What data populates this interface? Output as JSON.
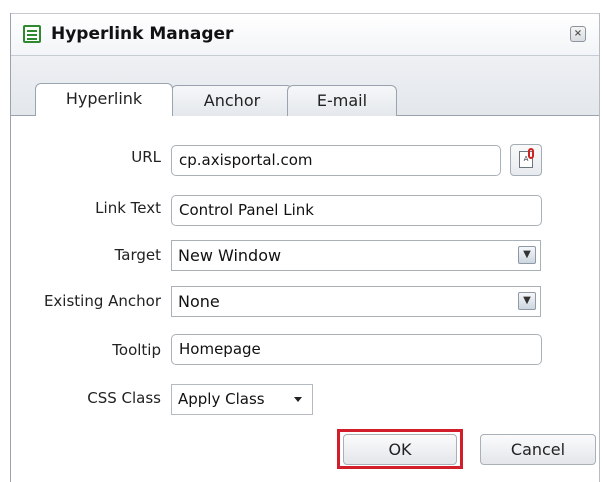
{
  "dialog": {
    "title": "Hyperlink Manager",
    "close_glyph": "×"
  },
  "tabs": [
    {
      "label": "Hyperlink",
      "active": true
    },
    {
      "label": "Anchor",
      "active": false
    },
    {
      "label": "E-mail",
      "active": false
    }
  ],
  "form": {
    "url": {
      "label": "URL",
      "value": "cp.axisportal.com"
    },
    "link_text": {
      "label": "Link Text",
      "value": "Control Panel Link"
    },
    "target": {
      "label": "Target",
      "value": "New Window"
    },
    "existing_anchor": {
      "label": "Existing Anchor",
      "value": "None"
    },
    "tooltip": {
      "label": "Tooltip",
      "value": "Homepage"
    },
    "css_class": {
      "label": "CSS Class",
      "value": "Apply Class"
    }
  },
  "buttons": {
    "ok": "OK",
    "cancel": "Cancel"
  },
  "icons": {
    "app": "hyperlink-manager-icon",
    "picker": "document-picker-icon"
  },
  "colors": {
    "highlight": "#d21e2a",
    "app_icon": "#2e8a2e"
  }
}
